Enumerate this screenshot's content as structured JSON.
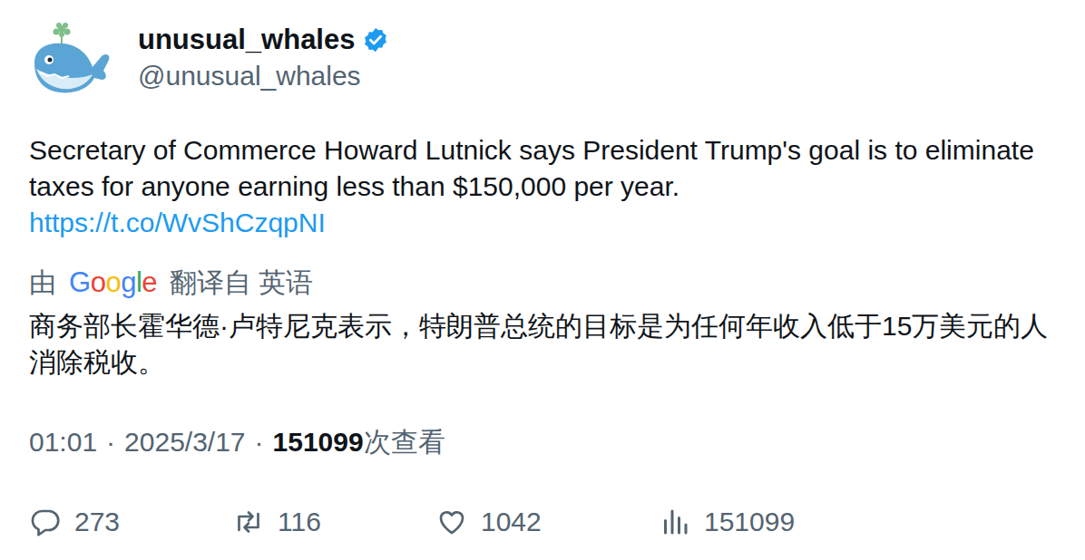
{
  "author": {
    "name": "unusual_whales",
    "handle": "@unusual_whales",
    "verified": true
  },
  "tweet": {
    "text": "Secretary of Commerce Howard Lutnick says President Trump's goal is to eliminate taxes for anyone earning less than $150,000 per year.",
    "link": "https://t.co/WvShCzqpNI"
  },
  "translation": {
    "prefix": "由",
    "brand": "Google",
    "suffix": "翻译自 英语",
    "text": "商务部长霍华德·卢特尼克表示，特朗普总统的目标是为任何年收入低于15万美元的人消除税收。"
  },
  "meta": {
    "time": "01:01",
    "separator": "·",
    "date": "2025/3/17",
    "views": "151099",
    "views_label": "次查看"
  },
  "actions": [
    {
      "kind": "reply",
      "count": "273"
    },
    {
      "kind": "retweet",
      "count": "116"
    },
    {
      "kind": "like",
      "count": "1042"
    },
    {
      "kind": "views",
      "count": "151099"
    }
  ]
}
